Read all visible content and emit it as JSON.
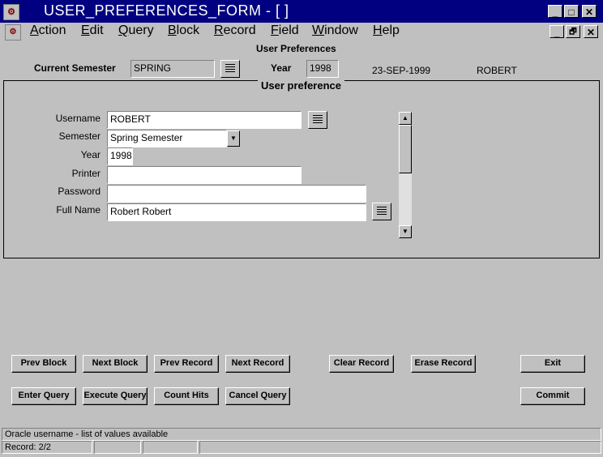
{
  "window": {
    "title": "USER_PREFERENCES_FORM - [ ]",
    "app_icon": "oracle-forms-icon",
    "controls": {
      "minimize": "_",
      "maximize": "□",
      "close": "✕",
      "restore": "🗗"
    }
  },
  "menu": {
    "items": [
      {
        "label": "Action",
        "accel": "A",
        "rest": "ction"
      },
      {
        "label": "Edit",
        "accel": "E",
        "rest": "dit"
      },
      {
        "label": "Query",
        "accel": "Q",
        "rest": "uery"
      },
      {
        "label": "Block",
        "accel": "B",
        "rest": "lock"
      },
      {
        "label": "Record",
        "accel": "R",
        "rest": "ecord"
      },
      {
        "label": "Field",
        "accel": "F",
        "rest": "ield"
      },
      {
        "label": "Window",
        "accel": "W",
        "rest": "indow"
      },
      {
        "label": "Help",
        "accel": "H",
        "rest": "elp"
      }
    ]
  },
  "header": {
    "section_title": "User Preferences",
    "current_semester_label": "Current Semester",
    "current_semester_value": "SPRING",
    "year_label": "Year",
    "year_value": "1998",
    "date": "23-SEP-1999",
    "user": "ROBERT"
  },
  "panel": {
    "title": "User preference",
    "fields": {
      "username": {
        "label": "Username",
        "value": "ROBERT"
      },
      "semester": {
        "label": "Semester",
        "value": "Spring Semester"
      },
      "year": {
        "label": "Year",
        "value": "1998"
      },
      "printer": {
        "label": "Printer",
        "value": ""
      },
      "password": {
        "label": "Password",
        "value": ""
      },
      "full_name": {
        "label": "Full Name",
        "value": "Robert  Robert"
      }
    }
  },
  "buttons": {
    "prev_block": "Prev Block",
    "next_block": "Next Block",
    "prev_record": "Prev Record",
    "next_record": "Next Record",
    "clear_record": "Clear Record",
    "erase_record": "Erase Record",
    "exit": "Exit",
    "enter_query": "Enter Query",
    "execute_query": "Execute Query",
    "count_hits": "Count Hits",
    "cancel_query": "Cancel Query",
    "commit": "Commit"
  },
  "status": {
    "hint": "Oracle username - list of values available",
    "record": "Record: 2/2"
  }
}
